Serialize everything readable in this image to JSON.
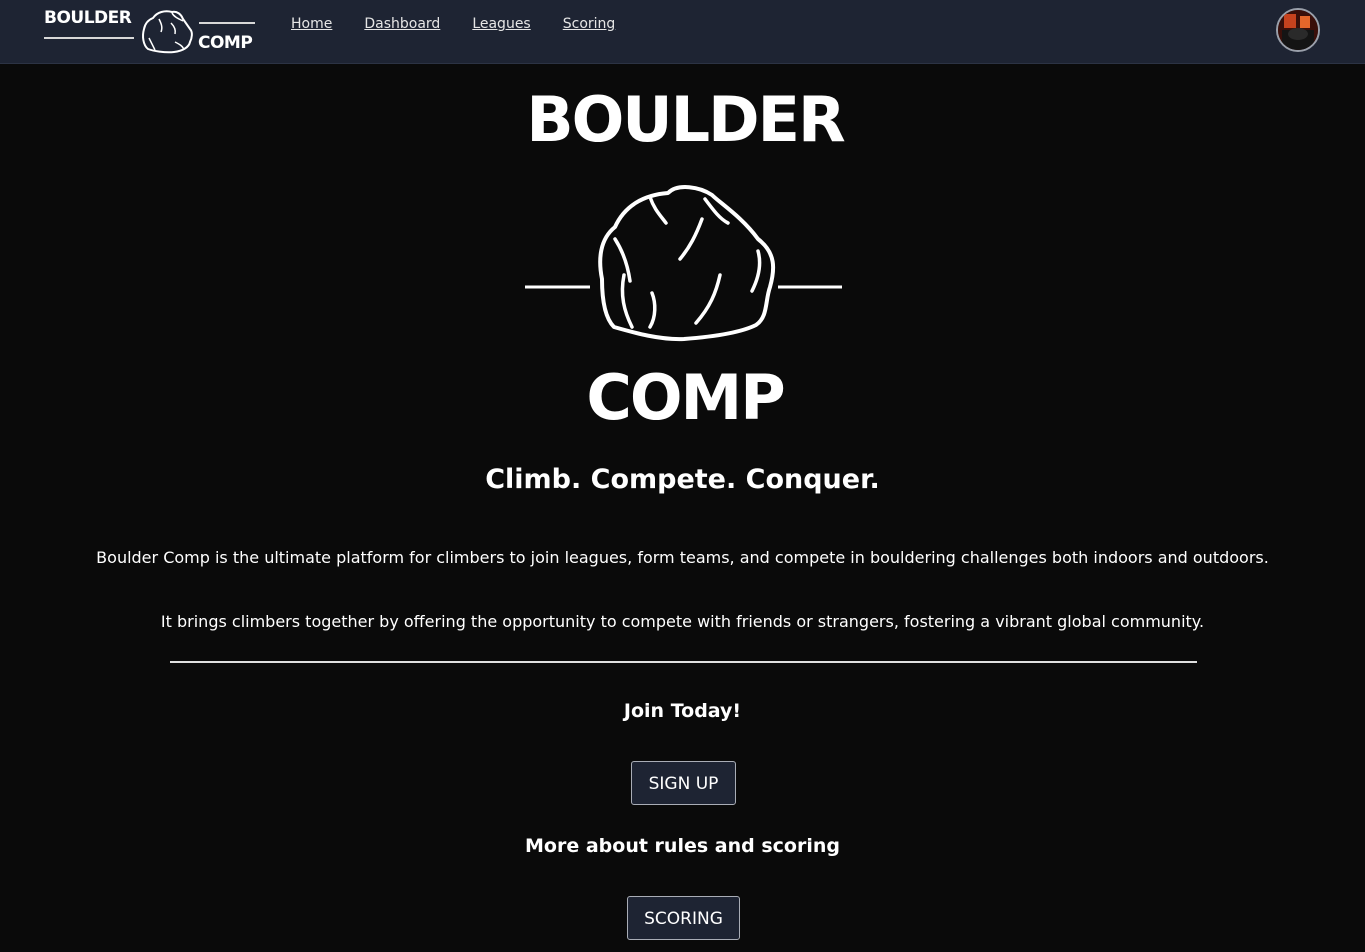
{
  "nav": {
    "logo_top": "BOULDER",
    "logo_bottom": "COMP",
    "links": [
      "Home",
      "Dashboard",
      "Leagues",
      "Scoring"
    ]
  },
  "hero": {
    "logo_top": "BOULDER",
    "logo_bottom": "COMP",
    "tagline": "Climb. Compete. Conquer.",
    "description_1": "Boulder Comp is the ultimate platform for climbers to join leagues, form teams, and compete in bouldering challenges both indoors and outdoors.",
    "description_2": "It brings climbers together by offering the opportunity to compete with friends or strangers, fostering a vibrant global community."
  },
  "join": {
    "heading": "Join Today!",
    "button_label": "SIGN UP"
  },
  "rules": {
    "heading": "More about rules and scoring",
    "button_label": "SCORING"
  },
  "colors": {
    "navbar_bg": "#1e2433",
    "page_bg": "#0a0a0a",
    "text": "#ffffff"
  }
}
